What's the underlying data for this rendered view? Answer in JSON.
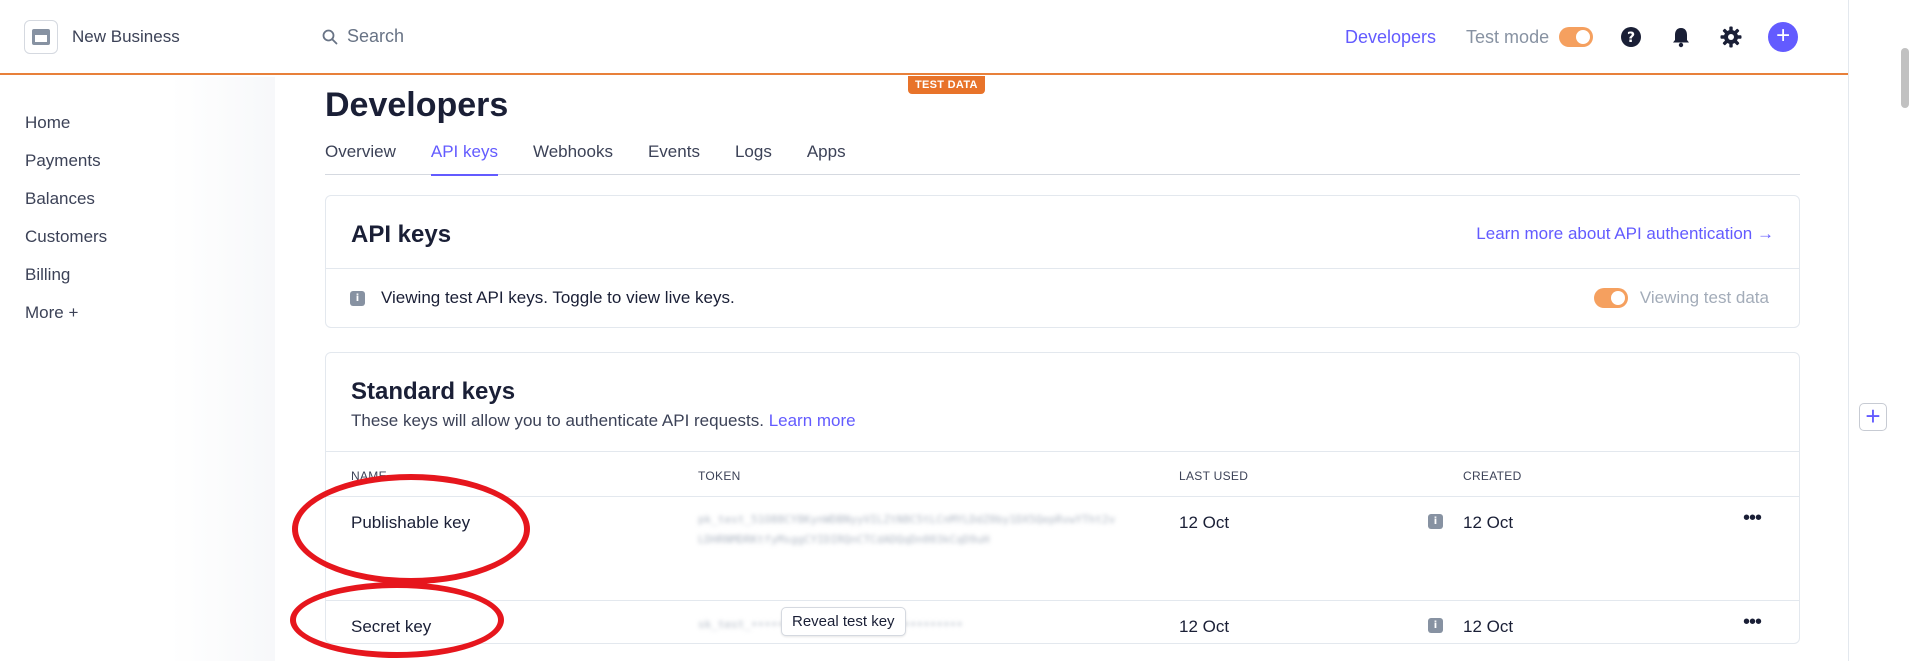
{
  "header": {
    "business_name": "New Business",
    "search_placeholder": "Search",
    "developers_link": "Developers",
    "test_mode_label": "Test mode",
    "test_mode_on": true
  },
  "test_data_badge": "TEST DATA",
  "sidebar": {
    "items": [
      {
        "label": "Home"
      },
      {
        "label": "Payments"
      },
      {
        "label": "Balances"
      },
      {
        "label": "Customers"
      },
      {
        "label": "Billing"
      },
      {
        "label": "More +"
      }
    ]
  },
  "page": {
    "title": "Developers",
    "tabs": [
      {
        "label": "Overview",
        "active": false
      },
      {
        "label": "API keys",
        "active": true
      },
      {
        "label": "Webhooks",
        "active": false
      },
      {
        "label": "Events",
        "active": false
      },
      {
        "label": "Logs",
        "active": false
      },
      {
        "label": "Apps",
        "active": false
      }
    ]
  },
  "api_keys_card": {
    "title": "API keys",
    "learn_more": "Learn more about API authentication →",
    "info_message": "Viewing test API keys. Toggle to view live keys.",
    "viewing_label": "Viewing test data"
  },
  "standard_keys": {
    "title": "Standard keys",
    "subtitle": "These keys will allow you to authenticate API requests.",
    "learn_more": "Learn more",
    "columns": {
      "name": "NAME",
      "token": "TOKEN",
      "last_used": "LAST USED",
      "created": "CREATED"
    },
    "rows": [
      {
        "name": "Publishable key",
        "token": "pk_test_51O88CY8KynWDBNyyVILZtN8C5tLCnMYLDdZ0by1DX5QepRvwYTht2vLDHRNMDRKtfyMsggCYIDIRQnCTCdADQqDn003kCqD9uH",
        "last_used": "12 Oct",
        "created": "12 Oct"
      },
      {
        "name": "Secret key",
        "token": "sk_test_••••••••••••••••••••••••••••••••",
        "reveal_label": "Reveal test key",
        "last_used": "12 Oct",
        "created": "12 Oct"
      }
    ]
  },
  "colors": {
    "accent": "#635bff",
    "test_mode_orange": "#e8732a",
    "annotation_red": "#e6161d"
  }
}
